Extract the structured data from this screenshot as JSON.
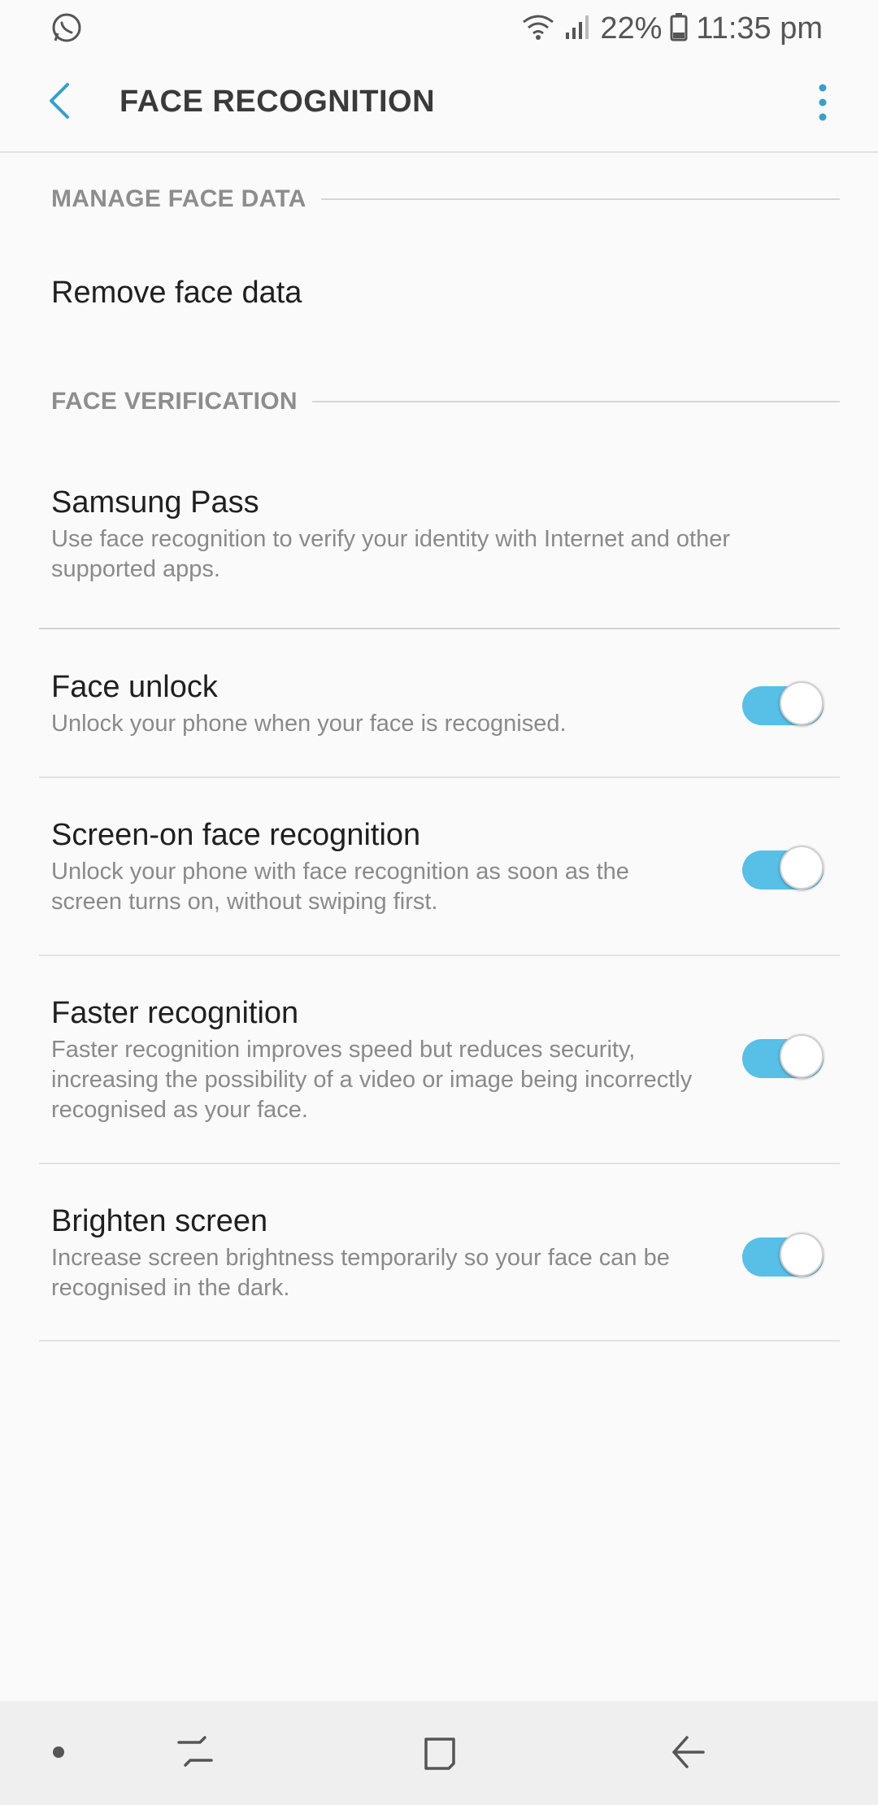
{
  "status_bar": {
    "battery": "22%",
    "time": "11:35 pm"
  },
  "app_bar": {
    "title": "FACE RECOGNITION"
  },
  "sections": {
    "manage": {
      "label": "MANAGE FACE DATA"
    },
    "verification": {
      "label": "FACE VERIFICATION"
    }
  },
  "items": {
    "remove_face_data": {
      "title": "Remove face data"
    },
    "samsung_pass": {
      "title": "Samsung Pass",
      "desc": "Use face recognition to verify your identity with Internet and other supported apps."
    },
    "face_unlock": {
      "title": "Face unlock",
      "desc": "Unlock your phone when your face is recognised.",
      "enabled": true
    },
    "screen_on": {
      "title": "Screen-on face recognition",
      "desc": "Unlock your phone with face recognition as soon as the screen turns on, without swiping first.",
      "enabled": true
    },
    "faster": {
      "title": "Faster recognition",
      "desc": "Faster recognition improves speed but reduces security, increasing the possibility of a video or image being incorrectly recognised as your face.",
      "enabled": true
    },
    "brighten": {
      "title": "Brighten screen",
      "desc": "Increase screen brightness temporarily so your face can be recognised in the dark.",
      "enabled": true
    }
  },
  "colors": {
    "accent": "#3a9fc7",
    "toggle_on": "#58bfe6",
    "background": "#fafafa",
    "nav_bar": "#efefef"
  },
  "icons": {
    "status_left": "whatsapp-icon",
    "status_right": [
      "wifi-icon",
      "signal-icon",
      "battery-icon"
    ],
    "app_bar": [
      "back-arrow-icon",
      "more-vertical-icon"
    ],
    "nav_bar": [
      "dot-icon",
      "recent-apps-icon",
      "home-icon",
      "back-icon"
    ]
  }
}
